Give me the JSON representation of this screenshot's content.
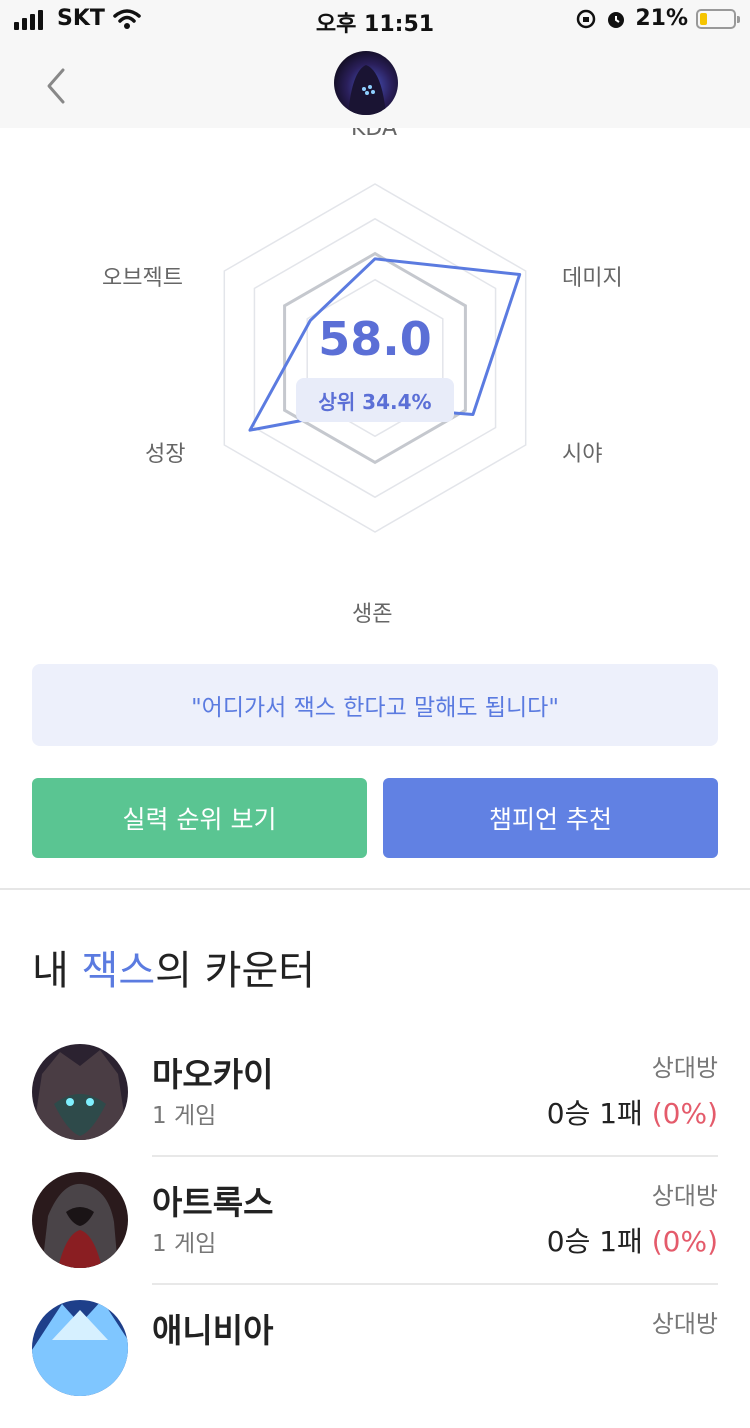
{
  "status_bar": {
    "carrier": "SKT",
    "time": "오후 11:51",
    "battery": "21%",
    "battery_level": 0.21
  },
  "header": {
    "back_icon": "chevron-left-icon",
    "avatar_icon": "champion-portrait"
  },
  "radar": {
    "labels": {
      "top": "KDA",
      "top_right": "데미지",
      "bottom_right": "시야",
      "bottom": "생존",
      "bottom_left": "성장",
      "top_left": "오브젝트"
    },
    "score": "58.0",
    "rank_text": "상위 34.4%",
    "values": {
      "kda": 0.57,
      "damage": 0.96,
      "vision": 0.65,
      "survival": 0.28,
      "growth": 0.83,
      "objective": 0.43
    },
    "colors": {
      "accent": "#5b7be0",
      "grid": "#e3e5ea",
      "mid": "#c5c8ce"
    }
  },
  "quote": "\"어디가서 잭스 한다고 말해도 됩니다\"",
  "buttons": {
    "rank": "실력 순위 보기",
    "recommend": "챔피언 추천"
  },
  "counters": {
    "title_prefix": "내 ",
    "title_champion": "잭스",
    "title_suffix": "의 카운터",
    "items": [
      {
        "name": "마오카이",
        "games": "1 게임",
        "opponent": "상대방",
        "record": "0승 1패",
        "rate": "(0%)"
      },
      {
        "name": "아트록스",
        "games": "1 게임",
        "opponent": "상대방",
        "record": "0승 1패",
        "rate": "(0%)"
      },
      {
        "name": "애니비아",
        "games": "",
        "opponent": "상대방",
        "record": "",
        "rate": ""
      }
    ]
  }
}
